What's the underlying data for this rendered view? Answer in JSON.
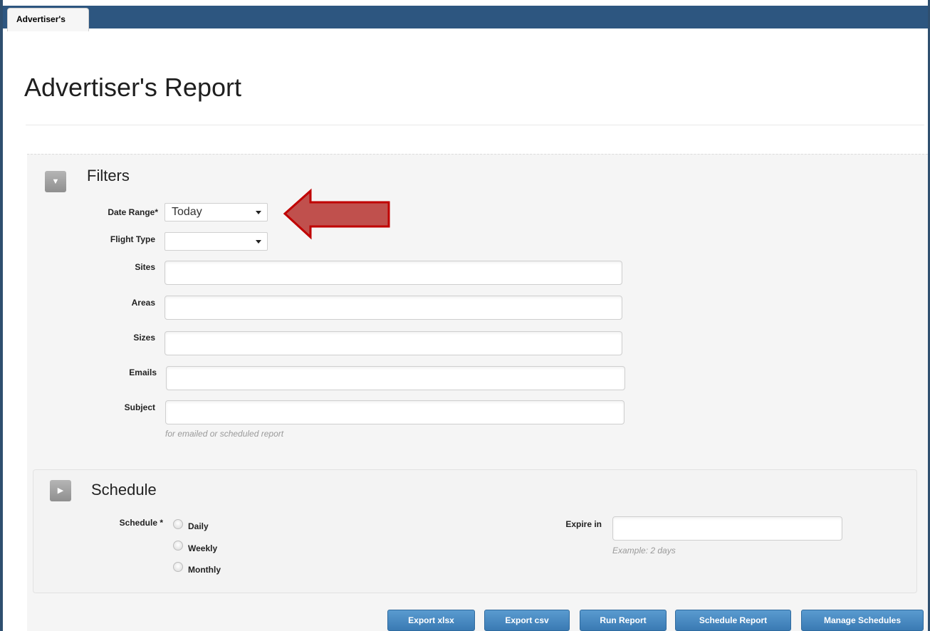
{
  "tabs": [
    {
      "label": "Advertiser's"
    }
  ],
  "page": {
    "title": "Advertiser's Report"
  },
  "filters": {
    "section_title": "Filters",
    "toggle_icon": "triangle-down-icon",
    "date_range": {
      "label": "Date Range*",
      "value": "Today"
    },
    "flight_type": {
      "label": "Flight Type",
      "value": ""
    },
    "sites": {
      "label": "Sites",
      "value": ""
    },
    "areas": {
      "label": "Areas",
      "value": ""
    },
    "sizes": {
      "label": "Sizes",
      "value": ""
    },
    "emails": {
      "label": "Emails",
      "value": ""
    },
    "subject": {
      "label": "Subject",
      "value": "",
      "hint": "for emailed or scheduled report"
    }
  },
  "schedule": {
    "section_title": "Schedule",
    "toggle_icon": "triangle-right-icon",
    "label": "Schedule *",
    "options": [
      {
        "label": "Daily"
      },
      {
        "label": "Weekly"
      },
      {
        "label": "Monthly"
      }
    ],
    "expire": {
      "label": "Expire in",
      "value": "",
      "hint": "Example: 2 days"
    }
  },
  "actions": {
    "export_xlsx": "Export xlsx",
    "export_csv": "Export csv",
    "run_report": "Run Report",
    "schedule_report": "Schedule Report",
    "manage_schedules": "Manage Schedules"
  },
  "annotation": {
    "arrow_color": "#c0504d",
    "arrow_border": "#c00000"
  },
  "colors": {
    "topbar": "#2d5680",
    "button": "#3a7ab3"
  }
}
